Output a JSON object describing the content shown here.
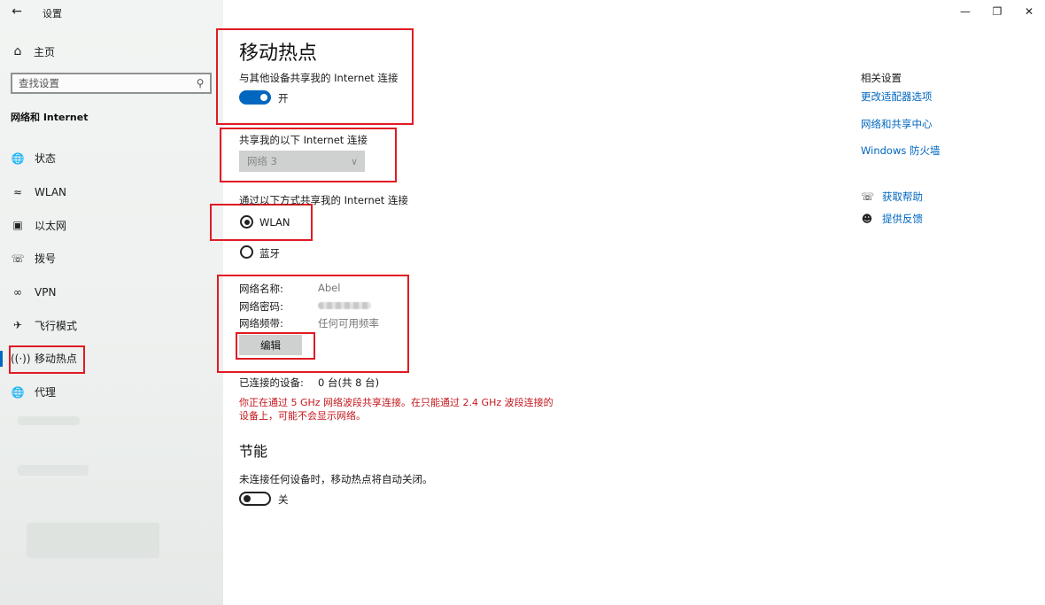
{
  "window": {
    "app_title": "设置",
    "minimize_label": "—",
    "restore_label": "❐",
    "close_label": "✕"
  },
  "sidebar": {
    "home_label": "主页",
    "search_placeholder": "查找设置",
    "section_title": "网络和 Internet",
    "items": [
      {
        "label": "状态",
        "icon": "globe-status-icon"
      },
      {
        "label": "WLAN",
        "icon": "wifi-icon"
      },
      {
        "label": "以太网",
        "icon": "ethernet-icon"
      },
      {
        "label": "拨号",
        "icon": "dialup-icon"
      },
      {
        "label": "VPN",
        "icon": "vpn-icon"
      },
      {
        "label": "飞行模式",
        "icon": "airplane-icon"
      },
      {
        "label": "移动热点",
        "icon": "hotspot-icon"
      },
      {
        "label": "代理",
        "icon": "proxy-globe-icon"
      }
    ],
    "active_index": 6
  },
  "main": {
    "title": "移动热点",
    "share_label": "与其他设备共享我的 Internet 连接",
    "share_toggle_text": "开",
    "share_from_label": "共享我的以下 Internet 连接",
    "share_from_value": "网络 3",
    "share_over_label": "通过以下方式共享我的 Internet 连接",
    "radio_wlan": "WLAN",
    "radio_bt": "蓝牙",
    "network_name_key": "网络名称:",
    "network_name_value": "Abel",
    "network_password_key": "网络密码:",
    "network_band_key": "网络频带:",
    "network_band_value": "任何可用频率",
    "edit_button": "编辑",
    "connected_key": "已连接的设备:",
    "connected_value": "0 台(共 8 台)",
    "warning": "你正在通过 5 GHz 网络波段共享连接。在只能通过 2.4 GHz 波段连接的设备上，可能不会显示网络。",
    "power_title": "节能",
    "power_label": "未连接任何设备时，移动热点将自动关闭。",
    "power_toggle_text": "关"
  },
  "related": {
    "title": "相关设置",
    "links": [
      "更改适配器选项",
      "网络和共享中心",
      "Windows 防火墙"
    ],
    "help": "获取帮助",
    "feedback": "提供反馈"
  },
  "colors": {
    "accent": "#0067c0",
    "highlight_red": "#e01b24",
    "warning_red": "#c4161c"
  }
}
